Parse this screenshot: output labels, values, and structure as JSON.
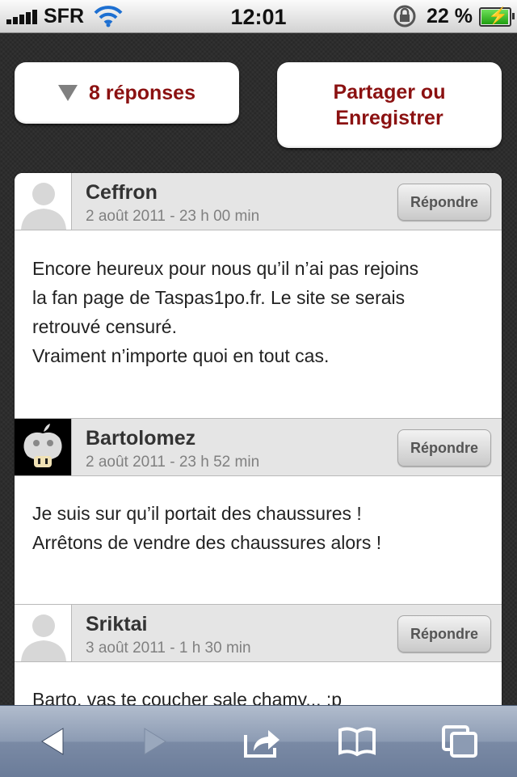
{
  "status_bar": {
    "carrier": "SFR",
    "time": "12:01",
    "battery_percent": "22 %",
    "battery_level": 0.22,
    "icons": [
      "signal-icon",
      "wifi-icon",
      "rotation-lock-icon",
      "battery-charging-icon"
    ]
  },
  "actions": {
    "replies_label": "8 réponses",
    "share_line1": "Partager ou",
    "share_line2": "Enregistrer"
  },
  "comments": [
    {
      "author": "Ceffron",
      "date": "2 août 2011 - 23 h 00 min",
      "reply_label": "Répondre",
      "avatar": "default-avatar-icon",
      "lines": [
        "Encore heureux pour nous qu’il n’ai pas rejoins",
        "la fan page de Taspas1po.fr. Le site se serais",
        "retrouvé censuré.",
        "Vraiment n’importe quoi en tout cas."
      ]
    },
    {
      "author": "Bartolomez",
      "date": "2 août 2011 - 23 h 52 min",
      "reply_label": "Répondre",
      "avatar": "apple-mushroom-avatar",
      "lines": [
        "Je suis sur qu’il portait des chaussures !",
        "Arrêtons de vendre des chaussures alors !"
      ]
    },
    {
      "author": "Sriktai",
      "date": "3 août 2011 - 1 h 30 min",
      "reply_label": "Répondre",
      "avatar": "default-avatar-icon",
      "lines": [
        "Barto, vas te coucher sale chamy... :p"
      ]
    }
  ],
  "toolbar": {
    "icons": [
      "back-arrow-icon",
      "forward-arrow-icon",
      "share-icon",
      "bookmarks-icon",
      "tabs-icon"
    ]
  },
  "colors": {
    "accent": "#8b1111",
    "toolbar": "#8c9bb3"
  }
}
